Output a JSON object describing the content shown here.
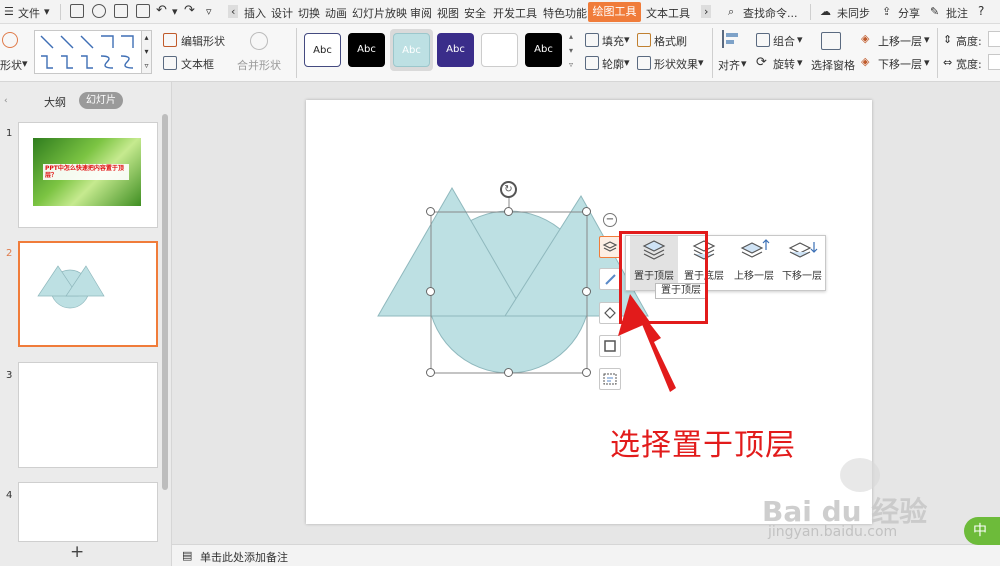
{
  "menubar": {
    "file_label": "文件",
    "tabs": [
      "插入",
      "设计",
      "切换",
      "动画",
      "幻灯片放映",
      "审阅",
      "视图",
      "安全",
      "开发工具",
      "特色功能"
    ],
    "active_tab": "绘图工具",
    "after_tab": "文本工具",
    "search": "查找命令...",
    "sync": "未同步",
    "share": "分享",
    "comment": "批注"
  },
  "ribbon": {
    "shape_label": "形状",
    "edit_shape": "编辑形状",
    "textbox": "文本框",
    "merge_shape": "合并形状",
    "style_text": "Abc",
    "fill": "填充",
    "format_brush": "格式刷",
    "outline": "轮廓",
    "shape_effect": "形状效果",
    "align": "对齐",
    "group": "组合",
    "rotate": "旋转",
    "selection_pane": "选择窗格",
    "bring_forward": "上移一层",
    "send_backward": "下移一层",
    "height_label": "高度:",
    "width_label": "宽度:"
  },
  "panel": {
    "tab_outline": "大纲",
    "tab_slides": "幻灯片",
    "slide_numbers": [
      "1",
      "2",
      "3",
      "4"
    ],
    "slide1_caption": "PPT中怎么快速把内容置于顶层？",
    "add_slide": "+"
  },
  "popup": {
    "items": [
      {
        "label": "置于顶层",
        "icon": "bring-to-front-icon"
      },
      {
        "label": "置于底层",
        "icon": "send-to-back-icon"
      },
      {
        "label": "上移一层",
        "icon": "bring-forward-icon"
      },
      {
        "label": "下移一层",
        "icon": "send-backward-icon"
      }
    ],
    "tooltip": "置于顶层"
  },
  "annotation": "选择置于顶层",
  "status": {
    "notes": "单击此处添加备注"
  },
  "watermark": {
    "brand": "Bai du 经验",
    "url": "jingyan.baidu.com"
  },
  "ime": "中",
  "colors": {
    "accent": "#f07c3a",
    "shape_fill": "#bde0e3",
    "shape_stroke": "#8fb8bd",
    "callout": "#e21b1b"
  }
}
